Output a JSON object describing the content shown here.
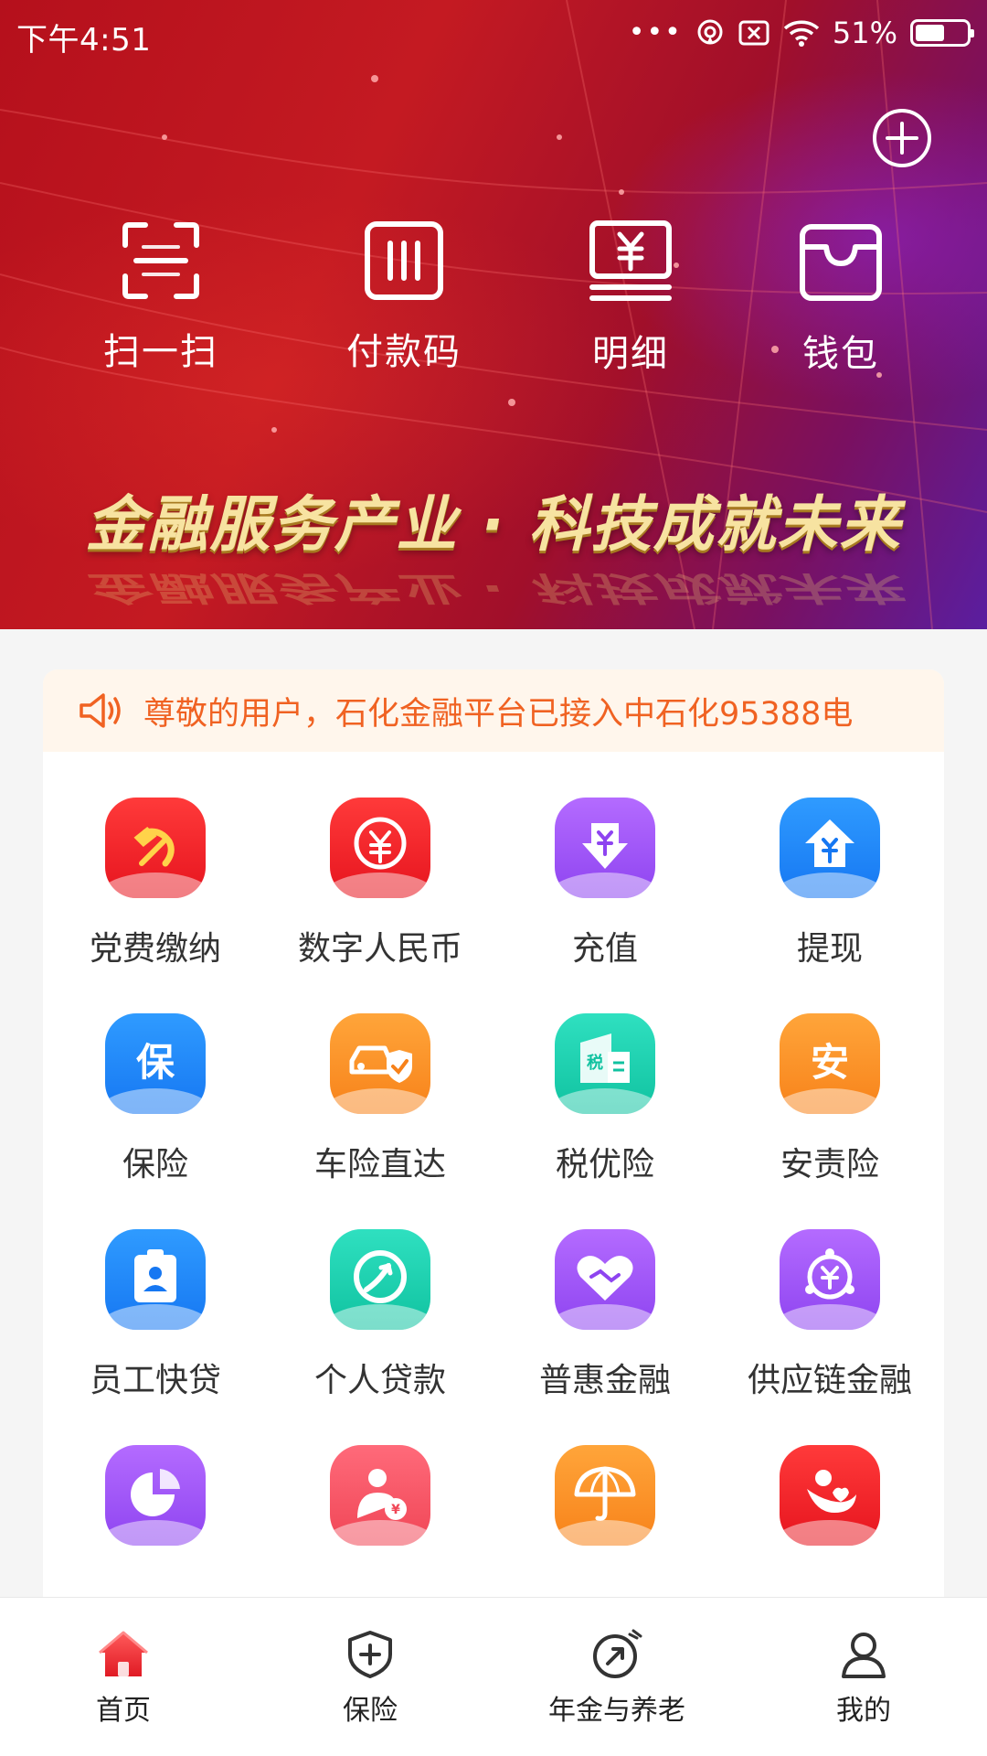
{
  "status_bar": {
    "time": "下午4:51",
    "dots": "•••",
    "battery": "51%"
  },
  "quick_actions": [
    {
      "label": "扫一扫",
      "icon": "scan-icon"
    },
    {
      "label": "付款码",
      "icon": "payment-code-icon"
    },
    {
      "label": "明细",
      "icon": "details-icon"
    },
    {
      "label": "钱包",
      "icon": "wallet-icon"
    }
  ],
  "banner": {
    "slogan": "金融服务产业 · 科技成就未来"
  },
  "notice": {
    "text": "尊敬的用户，石化金融平台已接入中石化95388电"
  },
  "services": [
    {
      "label": "党费缴纳",
      "icon": "party-emblem-icon",
      "color": "#e6141e"
    },
    {
      "label": "数字人民币",
      "icon": "digital-yuan-icon",
      "color": "#e6141e"
    },
    {
      "label": "充值",
      "icon": "recharge-icon",
      "color": "#8e44f0"
    },
    {
      "label": "提现",
      "icon": "withdraw-icon",
      "color": "#1677f2"
    },
    {
      "label": "保险",
      "icon": "insurance-icon",
      "color": "#1677f2"
    },
    {
      "label": "车险直达",
      "icon": "car-insurance-icon",
      "color": "#f7821a"
    },
    {
      "label": "税优险",
      "icon": "tax-insurance-icon",
      "color": "#10c2a0"
    },
    {
      "label": "安责险",
      "icon": "safety-insurance-icon",
      "color": "#f7821a"
    },
    {
      "label": "员工快贷",
      "icon": "employee-loan-icon",
      "color": "#1677f2"
    },
    {
      "label": "个人贷款",
      "icon": "personal-loan-icon",
      "color": "#10c2a0"
    },
    {
      "label": "普惠金融",
      "icon": "inclusive-finance-icon",
      "color": "#8e44f0"
    },
    {
      "label": "供应链金融",
      "icon": "supply-chain-finance-icon",
      "color": "#8e44f0"
    },
    {
      "label": "",
      "icon": "pie-chart-icon",
      "color": "#8e44f0"
    },
    {
      "label": "",
      "icon": "pension-person-icon",
      "color": "#f04656"
    },
    {
      "label": "",
      "icon": "umbrella-icon",
      "color": "#f7821a"
    },
    {
      "label": "",
      "icon": "care-icon",
      "color": "#e6141e"
    }
  ],
  "bottom_nav": [
    {
      "label": "首页",
      "icon": "home-icon",
      "active": true
    },
    {
      "label": "保险",
      "icon": "shield-plus-icon",
      "active": false
    },
    {
      "label": "年金与养老",
      "icon": "pension-icon",
      "active": false
    },
    {
      "label": "我的",
      "icon": "profile-icon",
      "active": false
    }
  ],
  "colors": {
    "accent": "#e6141e",
    "notice_text": "#f06222",
    "notice_bg": "#fff6ec"
  }
}
